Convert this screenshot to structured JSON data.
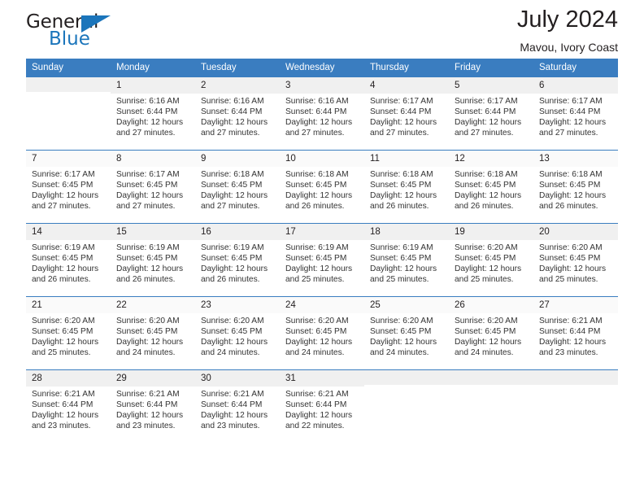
{
  "brand": {
    "name_part1": "General",
    "name_part2": "Blue",
    "accent_color": "#1b75bb"
  },
  "header": {
    "title": "July 2024",
    "subtitle": "Mavou, Ivory Coast",
    "header_bg": "#3a7dc0"
  },
  "weekday_headers": [
    "Sunday",
    "Monday",
    "Tuesday",
    "Wednesday",
    "Thursday",
    "Friday",
    "Saturday"
  ],
  "weeks": [
    [
      {
        "day": "",
        "lines": []
      },
      {
        "day": "1",
        "lines": [
          "Sunrise: 6:16 AM",
          "Sunset: 6:44 PM",
          "Daylight: 12 hours",
          "and 27 minutes."
        ]
      },
      {
        "day": "2",
        "lines": [
          "Sunrise: 6:16 AM",
          "Sunset: 6:44 PM",
          "Daylight: 12 hours",
          "and 27 minutes."
        ]
      },
      {
        "day": "3",
        "lines": [
          "Sunrise: 6:16 AM",
          "Sunset: 6:44 PM",
          "Daylight: 12 hours",
          "and 27 minutes."
        ]
      },
      {
        "day": "4",
        "lines": [
          "Sunrise: 6:17 AM",
          "Sunset: 6:44 PM",
          "Daylight: 12 hours",
          "and 27 minutes."
        ]
      },
      {
        "day": "5",
        "lines": [
          "Sunrise: 6:17 AM",
          "Sunset: 6:44 PM",
          "Daylight: 12 hours",
          "and 27 minutes."
        ]
      },
      {
        "day": "6",
        "lines": [
          "Sunrise: 6:17 AM",
          "Sunset: 6:44 PM",
          "Daylight: 12 hours",
          "and 27 minutes."
        ]
      }
    ],
    [
      {
        "day": "7",
        "lines": [
          "Sunrise: 6:17 AM",
          "Sunset: 6:45 PM",
          "Daylight: 12 hours",
          "and 27 minutes."
        ]
      },
      {
        "day": "8",
        "lines": [
          "Sunrise: 6:17 AM",
          "Sunset: 6:45 PM",
          "Daylight: 12 hours",
          "and 27 minutes."
        ]
      },
      {
        "day": "9",
        "lines": [
          "Sunrise: 6:18 AM",
          "Sunset: 6:45 PM",
          "Daylight: 12 hours",
          "and 27 minutes."
        ]
      },
      {
        "day": "10",
        "lines": [
          "Sunrise: 6:18 AM",
          "Sunset: 6:45 PM",
          "Daylight: 12 hours",
          "and 26 minutes."
        ]
      },
      {
        "day": "11",
        "lines": [
          "Sunrise: 6:18 AM",
          "Sunset: 6:45 PM",
          "Daylight: 12 hours",
          "and 26 minutes."
        ]
      },
      {
        "day": "12",
        "lines": [
          "Sunrise: 6:18 AM",
          "Sunset: 6:45 PM",
          "Daylight: 12 hours",
          "and 26 minutes."
        ]
      },
      {
        "day": "13",
        "lines": [
          "Sunrise: 6:18 AM",
          "Sunset: 6:45 PM",
          "Daylight: 12 hours",
          "and 26 minutes."
        ]
      }
    ],
    [
      {
        "day": "14",
        "lines": [
          "Sunrise: 6:19 AM",
          "Sunset: 6:45 PM",
          "Daylight: 12 hours",
          "and 26 minutes."
        ]
      },
      {
        "day": "15",
        "lines": [
          "Sunrise: 6:19 AM",
          "Sunset: 6:45 PM",
          "Daylight: 12 hours",
          "and 26 minutes."
        ]
      },
      {
        "day": "16",
        "lines": [
          "Sunrise: 6:19 AM",
          "Sunset: 6:45 PM",
          "Daylight: 12 hours",
          "and 26 minutes."
        ]
      },
      {
        "day": "17",
        "lines": [
          "Sunrise: 6:19 AM",
          "Sunset: 6:45 PM",
          "Daylight: 12 hours",
          "and 25 minutes."
        ]
      },
      {
        "day": "18",
        "lines": [
          "Sunrise: 6:19 AM",
          "Sunset: 6:45 PM",
          "Daylight: 12 hours",
          "and 25 minutes."
        ]
      },
      {
        "day": "19",
        "lines": [
          "Sunrise: 6:20 AM",
          "Sunset: 6:45 PM",
          "Daylight: 12 hours",
          "and 25 minutes."
        ]
      },
      {
        "day": "20",
        "lines": [
          "Sunrise: 6:20 AM",
          "Sunset: 6:45 PM",
          "Daylight: 12 hours",
          "and 25 minutes."
        ]
      }
    ],
    [
      {
        "day": "21",
        "lines": [
          "Sunrise: 6:20 AM",
          "Sunset: 6:45 PM",
          "Daylight: 12 hours",
          "and 25 minutes."
        ]
      },
      {
        "day": "22",
        "lines": [
          "Sunrise: 6:20 AM",
          "Sunset: 6:45 PM",
          "Daylight: 12 hours",
          "and 24 minutes."
        ]
      },
      {
        "day": "23",
        "lines": [
          "Sunrise: 6:20 AM",
          "Sunset: 6:45 PM",
          "Daylight: 12 hours",
          "and 24 minutes."
        ]
      },
      {
        "day": "24",
        "lines": [
          "Sunrise: 6:20 AM",
          "Sunset: 6:45 PM",
          "Daylight: 12 hours",
          "and 24 minutes."
        ]
      },
      {
        "day": "25",
        "lines": [
          "Sunrise: 6:20 AM",
          "Sunset: 6:45 PM",
          "Daylight: 12 hours",
          "and 24 minutes."
        ]
      },
      {
        "day": "26",
        "lines": [
          "Sunrise: 6:20 AM",
          "Sunset: 6:45 PM",
          "Daylight: 12 hours",
          "and 24 minutes."
        ]
      },
      {
        "day": "27",
        "lines": [
          "Sunrise: 6:21 AM",
          "Sunset: 6:44 PM",
          "Daylight: 12 hours",
          "and 23 minutes."
        ]
      }
    ],
    [
      {
        "day": "28",
        "lines": [
          "Sunrise: 6:21 AM",
          "Sunset: 6:44 PM",
          "Daylight: 12 hours",
          "and 23 minutes."
        ]
      },
      {
        "day": "29",
        "lines": [
          "Sunrise: 6:21 AM",
          "Sunset: 6:44 PM",
          "Daylight: 12 hours",
          "and 23 minutes."
        ]
      },
      {
        "day": "30",
        "lines": [
          "Sunrise: 6:21 AM",
          "Sunset: 6:44 PM",
          "Daylight: 12 hours",
          "and 23 minutes."
        ]
      },
      {
        "day": "31",
        "lines": [
          "Sunrise: 6:21 AM",
          "Sunset: 6:44 PM",
          "Daylight: 12 hours",
          "and 22 minutes."
        ]
      },
      {
        "day": "",
        "lines": []
      },
      {
        "day": "",
        "lines": []
      },
      {
        "day": "",
        "lines": []
      }
    ]
  ]
}
